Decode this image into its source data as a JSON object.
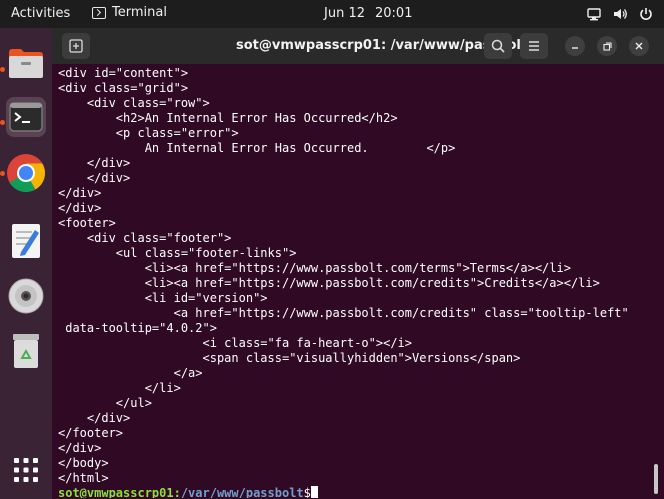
{
  "topbar": {
    "activities": "Activities",
    "app_name": "Terminal",
    "date": "Jun 12",
    "time": "20:01"
  },
  "dock": {
    "items": [
      {
        "name": "files"
      },
      {
        "name": "terminal"
      },
      {
        "name": "chrome"
      },
      {
        "name": "text-editor"
      },
      {
        "name": "disc"
      },
      {
        "name": "trash"
      },
      {
        "name": "show-apps"
      }
    ]
  },
  "terminal": {
    "title": "sot@vmwpasscrp01: /var/www/passbolt",
    "lines": [
      "<div id=\"content\">",
      "<div class=\"grid\">",
      "    <div class=\"row\">",
      "        <h2>An Internal Error Has Occurred</h2>",
      "        <p class=\"error\">",
      "            An Internal Error Has Occurred.        </p>",
      "    </div>",
      "    </div>",
      "</div>",
      "</div>",
      "<footer>",
      "    <div class=\"footer\">",
      "        <ul class=\"footer-links\">",
      "            <li><a href=\"https://www.passbolt.com/terms\">Terms</a></li>",
      "            <li><a href=\"https://www.passbolt.com/credits\">Credits</a></li>",
      "            <li id=\"version\">",
      "                <a href=\"https://www.passbolt.com/credits\" class=\"tooltip-left\"",
      " data-tooltip=\"4.0.2\">",
      "                    <i class=\"fa fa-heart-o\"></i>",
      "                    <span class=\"visuallyhidden\">Versions</span>",
      "                </a>",
      "            </li>",
      "        </ul>",
      "    </div>",
      "</footer>",
      "</div>",
      "</body>",
      "</html>"
    ],
    "prompt_user": "sot@vmwpasscrp01",
    "prompt_sep": ":",
    "prompt_path": "/var/www/passbolt",
    "prompt_symbol": "$"
  }
}
